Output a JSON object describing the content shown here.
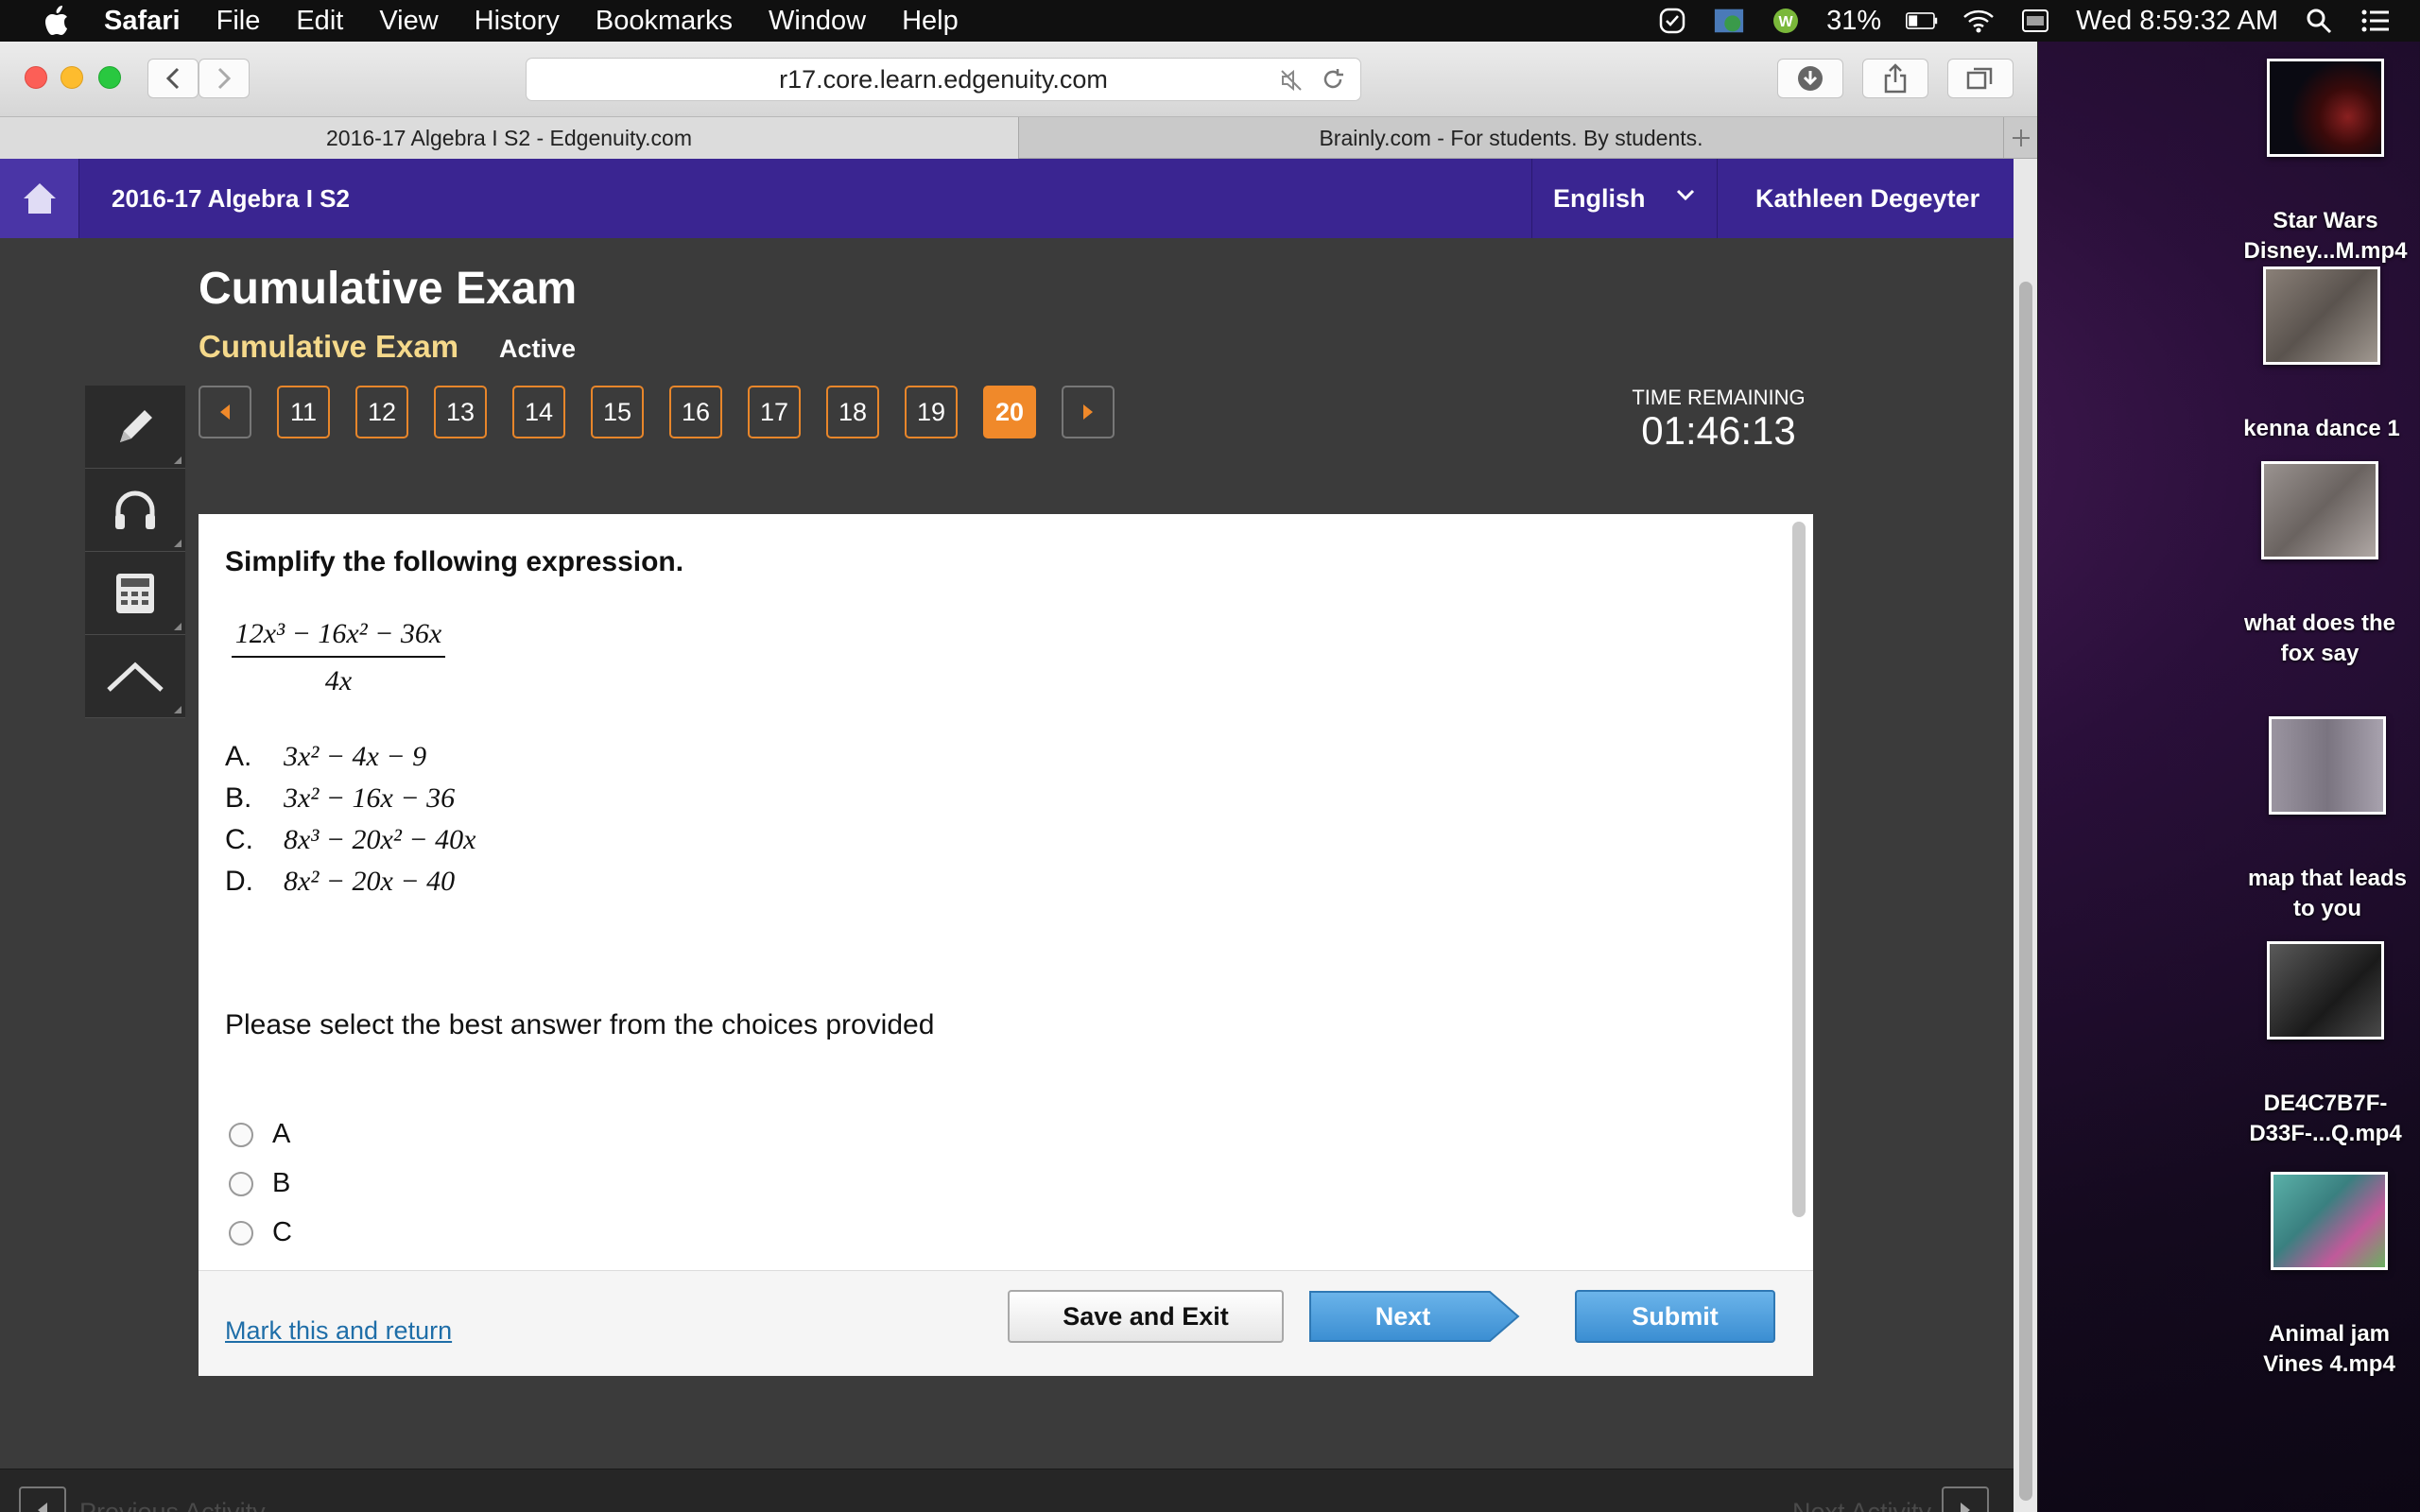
{
  "menubar": {
    "app": "Safari",
    "items": [
      "File",
      "Edit",
      "View",
      "History",
      "Bookmarks",
      "Window",
      "Help"
    ],
    "battery": "31%",
    "clock": "Wed 8:59:32 AM"
  },
  "browser": {
    "url": "r17.core.learn.edgenuity.com",
    "tabs": [
      {
        "title": "2016-17 Algebra I S2 - Edgenuity.com"
      },
      {
        "title": "Brainly.com - For students. By students."
      }
    ]
  },
  "header": {
    "course": "2016-17 Algebra I S2",
    "language": "English",
    "user": "Kathleen Degeyter"
  },
  "exam": {
    "title": "Cumulative Exam",
    "subtitle": "Cumulative Exam",
    "status": "Active",
    "questions": [
      "11",
      "12",
      "13",
      "14",
      "15",
      "16",
      "17",
      "18",
      "19",
      "20"
    ],
    "current": "20",
    "time_label": "TIME REMAINING",
    "time_value": "01:46:13"
  },
  "question": {
    "prompt": "Simplify the following expression.",
    "numerator": "12x³ − 16x² − 36x",
    "denominator": "4x",
    "choices": [
      {
        "letter": "A.",
        "expr": "3x² − 4x − 9"
      },
      {
        "letter": "B.",
        "expr": "3x² − 16x − 36"
      },
      {
        "letter": "C.",
        "expr": "8x³ − 20x² − 40x"
      },
      {
        "letter": "D.",
        "expr": "8x² − 20x − 40"
      }
    ],
    "instruction": "Please select the best answer from the choices provided",
    "options": [
      "A",
      "B",
      "C"
    ]
  },
  "footer": {
    "mark": "Mark this and return",
    "save": "Save and Exit",
    "next": "Next",
    "submit": "Submit"
  },
  "bottom": {
    "prev": "Previous Activity",
    "next": "Next Activity"
  },
  "desktop": [
    {
      "label": "Star Wars Disney...M.mp4",
      "color": "#1a1018"
    },
    {
      "label": "kenna dance 1",
      "color": "#6b6560"
    },
    {
      "label": "what does the fox say",
      "color": "#7a7370"
    },
    {
      "label": "map that leads to you",
      "color": "#8a8490"
    },
    {
      "label": "DE4C7B7F-D33F-...Q.mp4",
      "color": "#3a3a3a"
    },
    {
      "label": "Animal jam Vines 4.mp4",
      "color": "#4a9a9a"
    }
  ],
  "colors": {
    "brand_purple": "#3a2591",
    "accent_orange": "#f0892a",
    "submit_blue": "#3b8ed2"
  }
}
